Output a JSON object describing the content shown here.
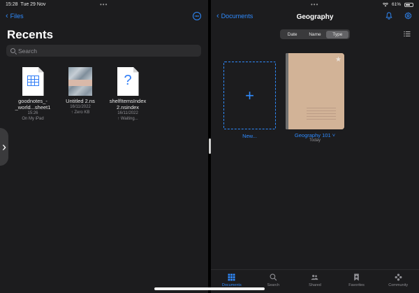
{
  "status": {
    "time": "15:28",
    "date": "Tue 29 Nov",
    "battery": "61%"
  },
  "left_pane": {
    "back_label": "Files",
    "title": "Recents",
    "search_placeholder": "Search",
    "files": [
      {
        "name_line1": "goodnotes_-",
        "name_line2": "_world...sheet1",
        "meta1": "15:26",
        "meta2": "On My iPad",
        "icon": "spreadsheet-icon"
      },
      {
        "name_line1": "Untitled 2.ns",
        "name_line2": "",
        "meta1": "16/11/2022",
        "meta2": "↑ Zero KB",
        "icon": "notebook-thumbnail"
      },
      {
        "name_line1": "shelfItemsIndex",
        "name_line2": "2.nsindex",
        "meta1": "16/11/2022",
        "meta2": "↑ Waiting...",
        "icon": "unknown-file-icon"
      }
    ]
  },
  "right_pane": {
    "back_label": "Documents",
    "title": "Geography",
    "sort_options": [
      "Date",
      "Name",
      "Type"
    ],
    "sort_selected": "Type",
    "new_label": "New...",
    "notebook": {
      "title": "Geography 101 ˅",
      "subtitle": "Today"
    },
    "tabs": [
      "Documents",
      "Search",
      "Shared",
      "Favorites",
      "Community"
    ],
    "active_tab": "Documents"
  },
  "colors": {
    "accent": "#2f8bff",
    "background": "#1c1c1e",
    "notebook_cover": "#d2b397"
  }
}
